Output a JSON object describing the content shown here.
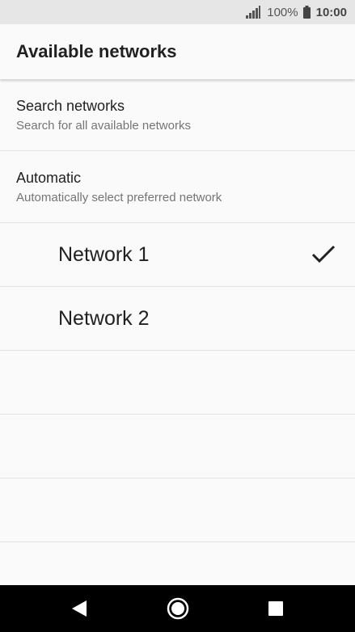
{
  "status_bar": {
    "battery_percent": "100%",
    "time": "10:00",
    "icons": [
      "signal-icon",
      "battery-icon"
    ]
  },
  "app_bar": {
    "title": "Available networks"
  },
  "preferences": [
    {
      "title": "Search networks",
      "summary": "Search for all available networks"
    },
    {
      "title": "Automatic",
      "summary": "Automatically select preferred network"
    }
  ],
  "networks": [
    {
      "label": "Network 1",
      "selected": true
    },
    {
      "label": "Network 2",
      "selected": false
    }
  ],
  "nav_bar": {
    "buttons": [
      "back-icon",
      "home-icon",
      "recents-icon"
    ]
  }
}
